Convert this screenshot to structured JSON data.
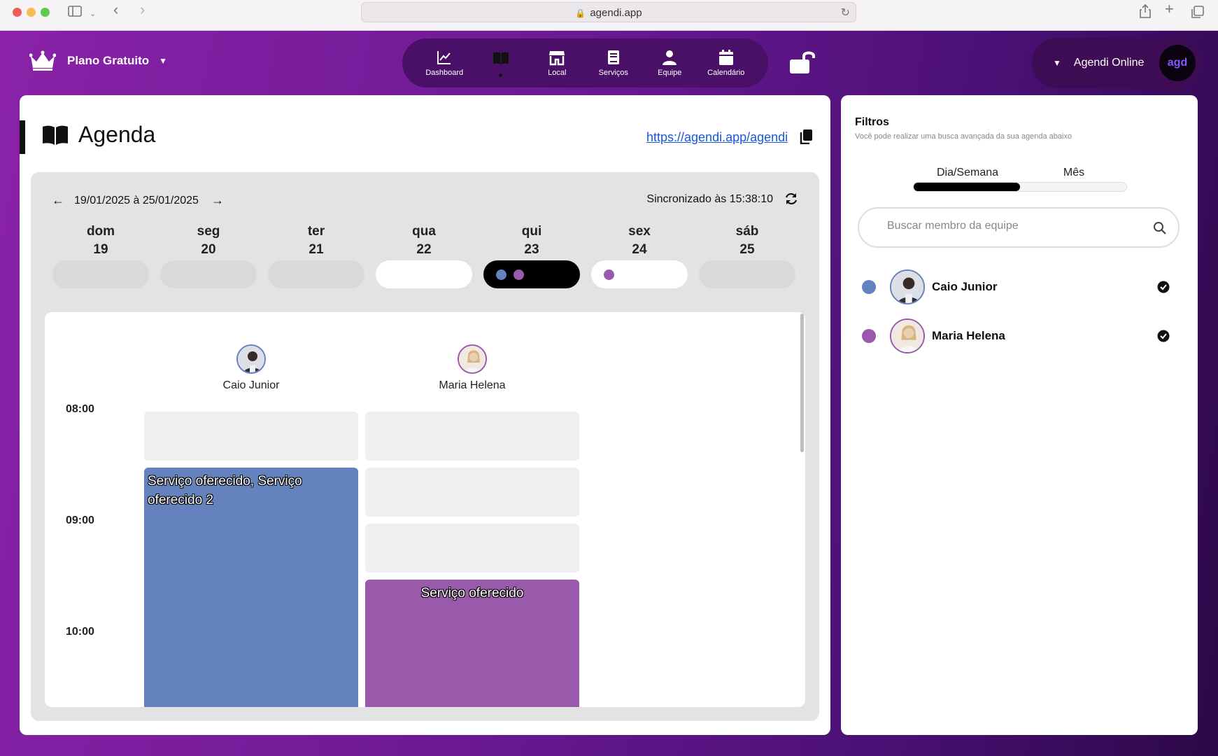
{
  "browser": {
    "url": "agendi.app"
  },
  "header": {
    "plan_label": "Plano Gratuito",
    "nav": [
      {
        "label": "Dashboard",
        "icon": "chart-icon"
      },
      {
        "label": "",
        "icon": "book-icon",
        "active": true
      },
      {
        "label": "Local",
        "icon": "store-icon"
      },
      {
        "label": "Serviços",
        "icon": "book-closed-icon"
      },
      {
        "label": "Equipe",
        "icon": "person-icon"
      },
      {
        "label": "Calendário",
        "icon": "calendar-icon"
      }
    ],
    "account_name": "Agendi Online",
    "account_avatar_text": "agd"
  },
  "main": {
    "title": "Agenda",
    "link": "https://agendi.app/agendi",
    "week_range": "19/01/2025 à 25/01/2025",
    "sync_text": "Sincronizado às 15:38:10",
    "days": [
      {
        "name": "dom",
        "num": "19",
        "state": "empty",
        "dots": []
      },
      {
        "name": "seg",
        "num": "20",
        "state": "empty",
        "dots": []
      },
      {
        "name": "ter",
        "num": "21",
        "state": "empty",
        "dots": []
      },
      {
        "name": "qua",
        "num": "22",
        "state": "white",
        "dots": []
      },
      {
        "name": "qui",
        "num": "23",
        "state": "selected",
        "dots": [
          "#6483be",
          "#9a5aab"
        ]
      },
      {
        "name": "sex",
        "num": "24",
        "state": "white",
        "dots": [
          "#9a5aab"
        ]
      },
      {
        "name": "sáb",
        "num": "25",
        "state": "empty",
        "dots": []
      }
    ],
    "members": [
      {
        "name": "Caio Junior",
        "color": "#6483be"
      },
      {
        "name": "Maria Helena",
        "color": "#9a5aab"
      }
    ],
    "times": [
      "08:00",
      "09:00",
      "10:00"
    ],
    "events": [
      {
        "member": "Caio Junior",
        "title": "Serviço oferecido, Serviço oferecido 2"
      },
      {
        "member": "Maria Helena",
        "title": "Serviço oferecido"
      }
    ]
  },
  "filters": {
    "title": "Filtros",
    "subtitle": "Você pode realizar uma busca avançada da sua agenda abaixo",
    "tab_day_week": "Dia/Semana",
    "tab_month": "Mês",
    "search_placeholder": "Buscar membro da equipe",
    "members": [
      {
        "name": "Caio Junior",
        "color": "#6483be",
        "checked": true
      },
      {
        "name": "Maria Helena",
        "color": "#9a5aab",
        "checked": true
      }
    ]
  },
  "colors": {
    "accent": "#6e1a96",
    "blue_member": "#6483be",
    "purple_member": "#9a5aab"
  }
}
